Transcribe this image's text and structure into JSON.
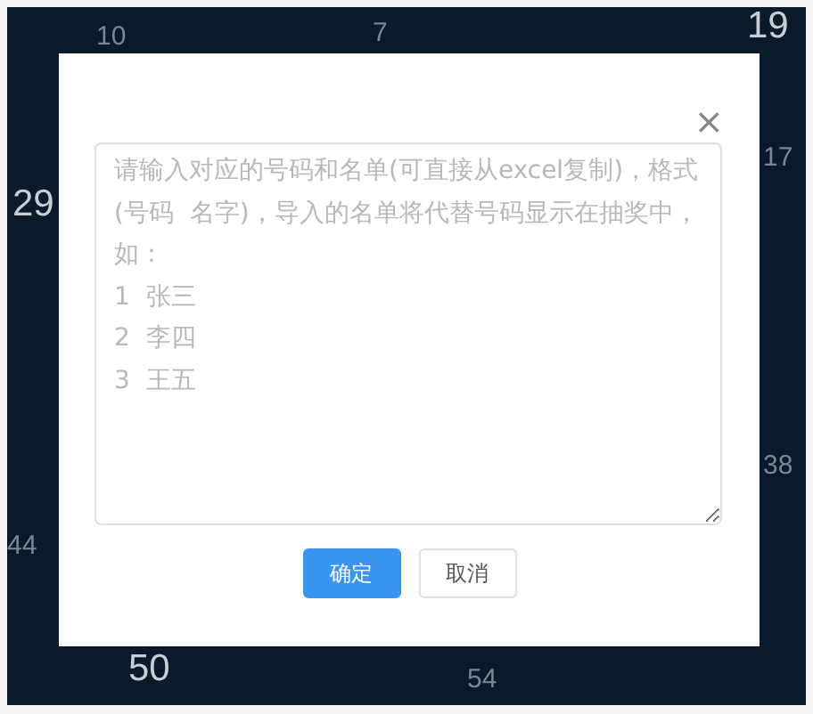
{
  "background_numbers": [
    "10",
    "7",
    "19",
    "17",
    "29",
    "38",
    "44",
    "50",
    "54"
  ],
  "dialog": {
    "close": "×",
    "textarea": {
      "placeholder": "请输入对应的号码和名单(可直接从excel复制)，格式(号码  名字)，导入的名单将代替号码显示在抽奖中，如：\n1  张三\n2  李四\n3  王五"
    },
    "buttons": [
      {
        "label": "确定",
        "kind": "primary"
      },
      {
        "label": "取消",
        "kind": "default"
      }
    ]
  }
}
